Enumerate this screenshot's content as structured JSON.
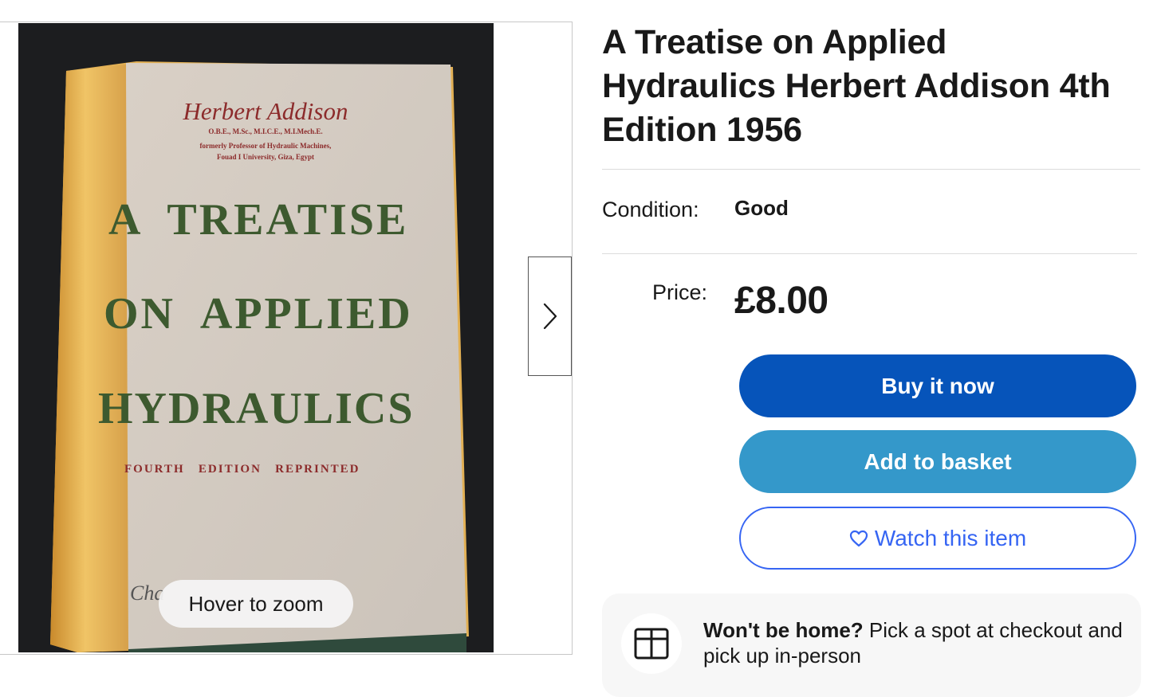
{
  "gallery": {
    "book_cover": {
      "author": "Herbert  Addison",
      "credentials": "O.B.E., M.Sc., M.I.C.E., M.I.Mech.E.",
      "affiliation_1": "formerly Professor of Hydraulic Machines,",
      "affiliation_2": "Fouad I University, Giza, Egypt",
      "title_line_1": "A  TREATISE",
      "title_line_2": "ON  APPLIED",
      "title_line_3": "HYDRAULICS",
      "edition": "FOURTH   EDITION   REPRINTED",
      "publisher_partial": "Cha"
    },
    "zoom_hint": "Hover to zoom",
    "next_icon": "chevron-right-icon"
  },
  "listing": {
    "title": "A Treatise on Applied Hydraulics Herbert Addison 4th Edition 1956",
    "condition_label": "Condition:",
    "condition_value": "Good",
    "price_label": "Price:",
    "price_value": "£8.00"
  },
  "actions": {
    "buy_now": "Buy it now",
    "add_to_basket": "Add to basket",
    "watch": "Watch this item",
    "watch_icon": "heart-icon"
  },
  "promo": {
    "icon": "box-icon",
    "bold": "Won't be home?",
    "text": " Pick a spot at checkout and pick up in-person"
  },
  "colors": {
    "buy_now_bg": "#0654ba",
    "basket_bg": "#3498ca",
    "watch_accent": "#3665f3",
    "cover_red": "#8c2b2b",
    "cover_green": "#3d5a2f"
  }
}
